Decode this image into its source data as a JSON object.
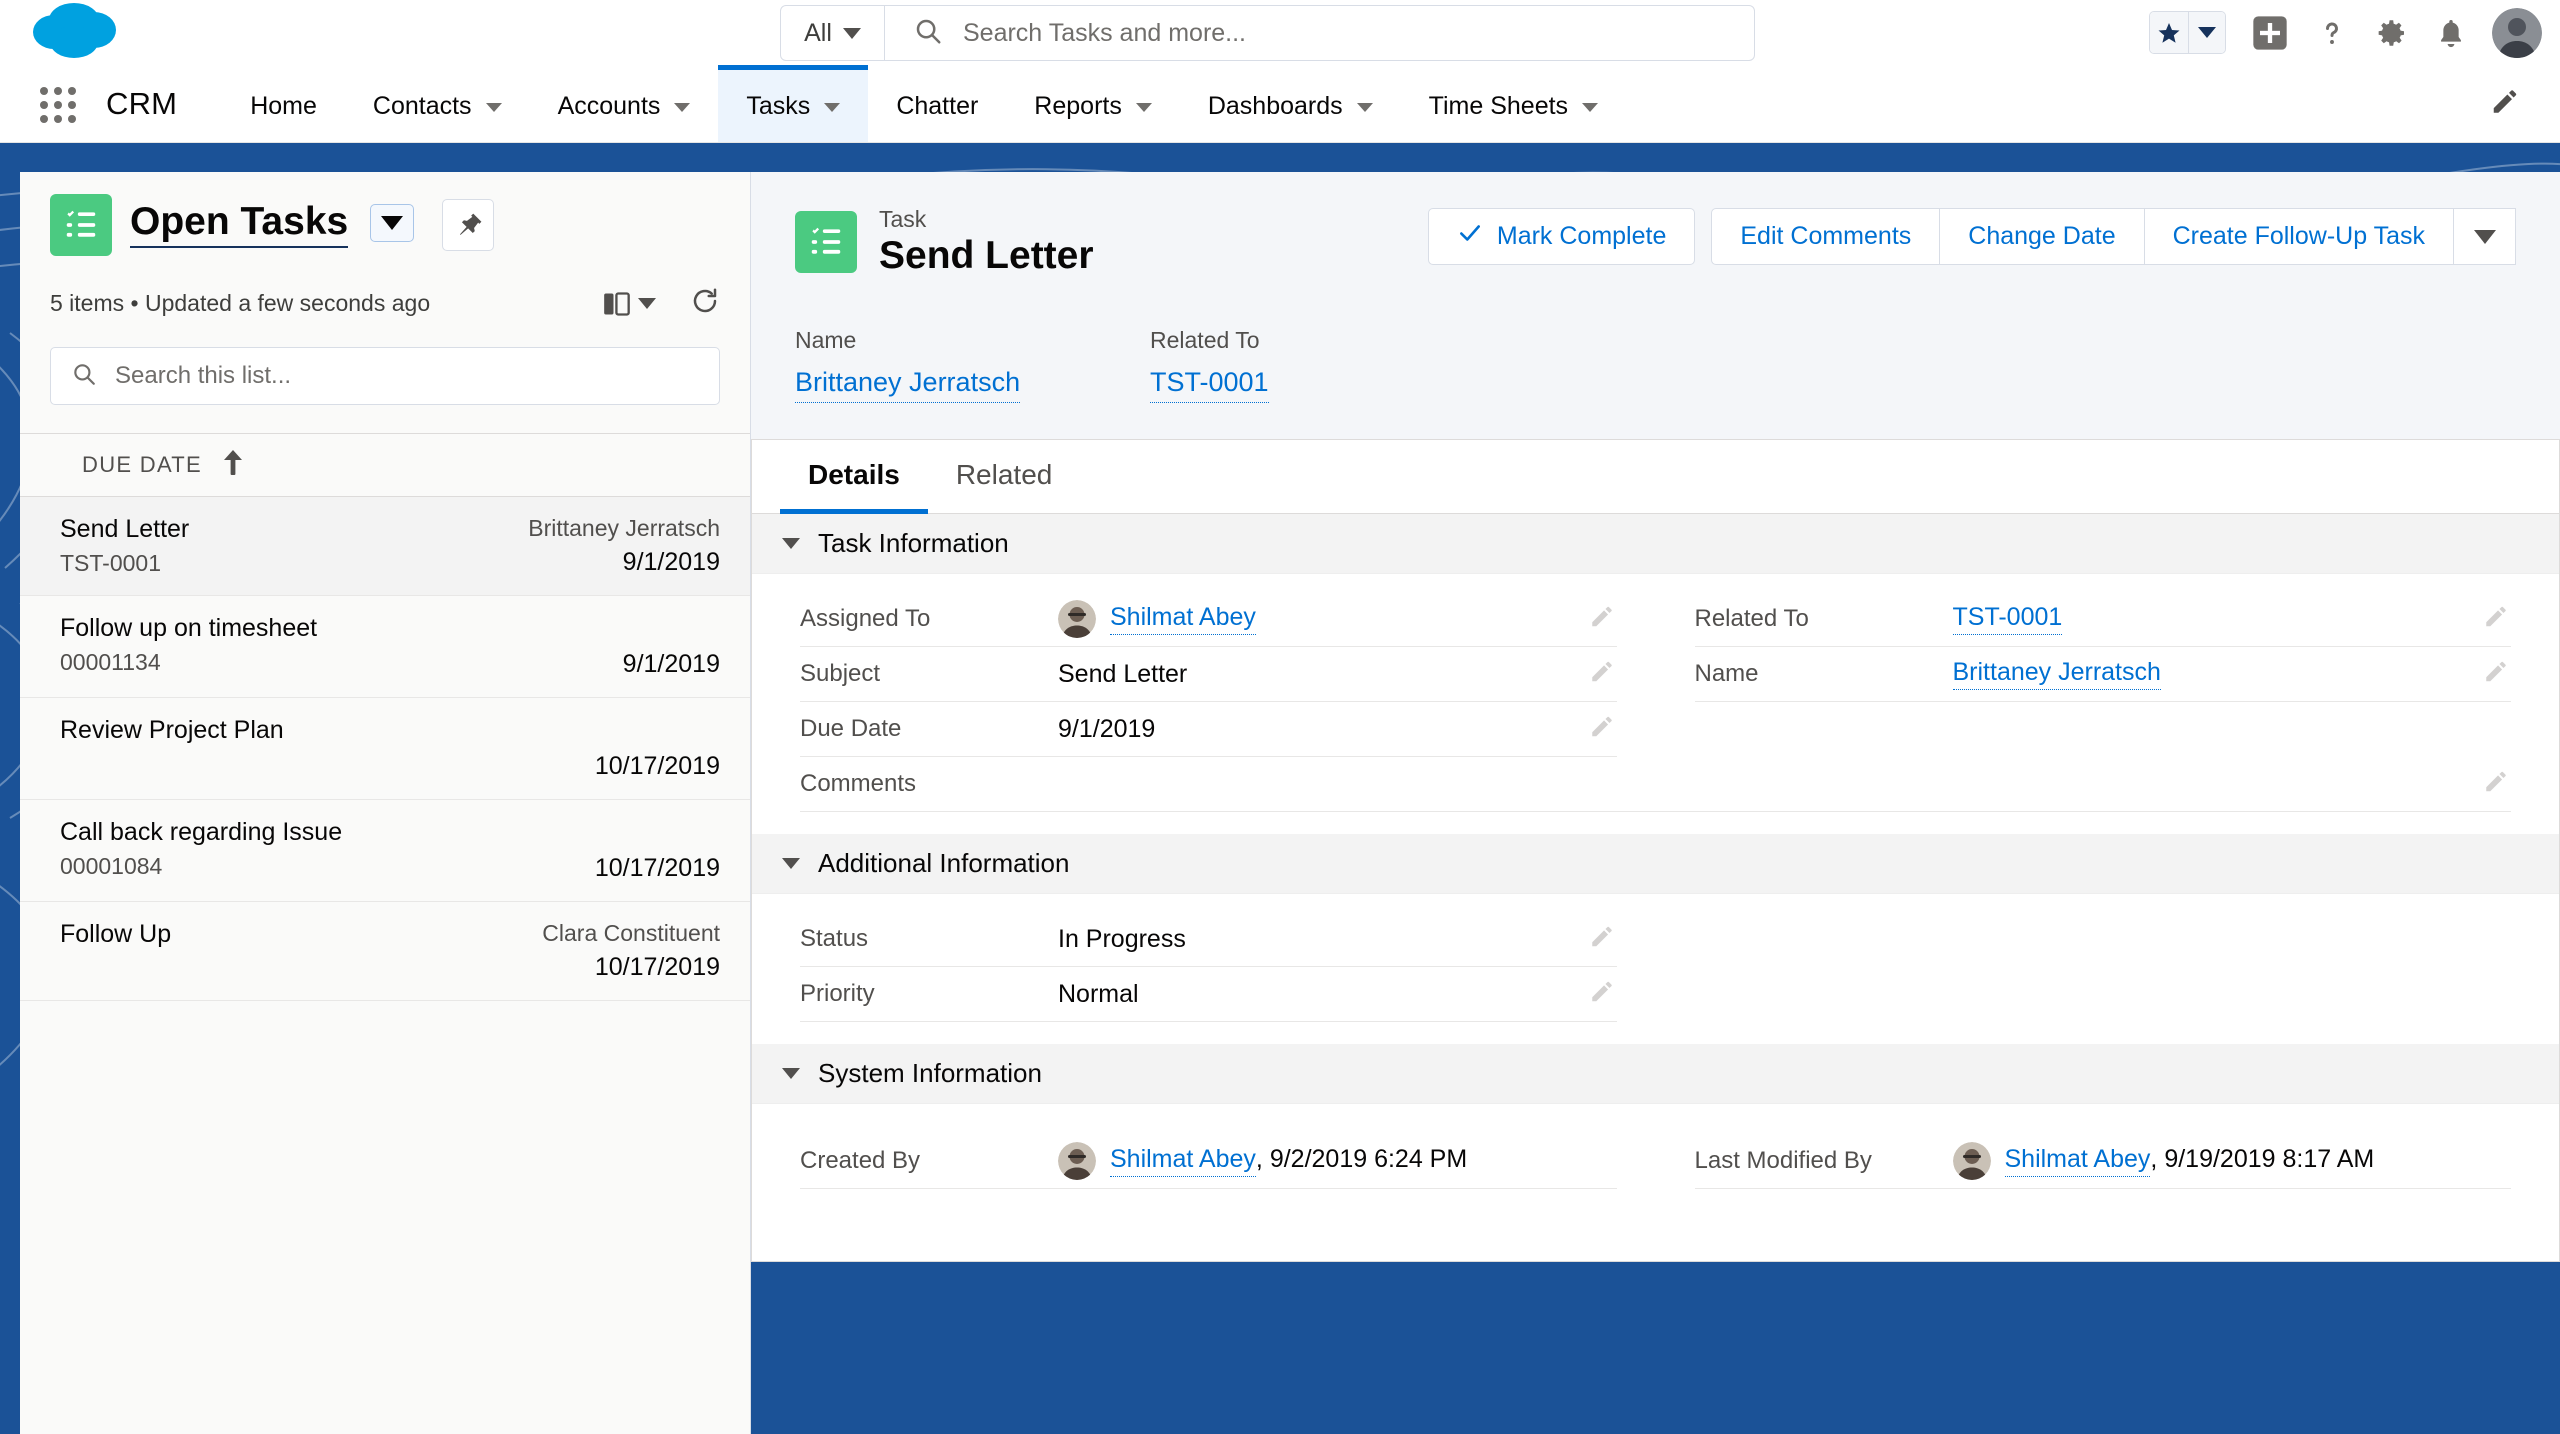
{
  "header": {
    "logo": "salesforce-cloud-logo",
    "search": {
      "scope_label": "All",
      "placeholder": "Search Tasks and more...",
      "value": ""
    },
    "icons": [
      "favorites-star-icon",
      "favorites-caret-icon",
      "add-icon",
      "help-icon",
      "setup-gear-icon",
      "notifications-bell-icon",
      "user-avatar"
    ]
  },
  "nav": {
    "app_name": "CRM",
    "items": [
      {
        "label": "Home",
        "has_caret": false,
        "active": false
      },
      {
        "label": "Contacts",
        "has_caret": true,
        "active": false
      },
      {
        "label": "Accounts",
        "has_caret": true,
        "active": false
      },
      {
        "label": "Tasks",
        "has_caret": true,
        "active": true
      },
      {
        "label": "Chatter",
        "has_caret": false,
        "active": false
      },
      {
        "label": "Reports",
        "has_caret": true,
        "active": false
      },
      {
        "label": "Dashboards",
        "has_caret": true,
        "active": false
      },
      {
        "label": "Time Sheets",
        "has_caret": true,
        "active": false
      }
    ],
    "edit_icon": "pencil-icon"
  },
  "list_panel": {
    "title": "Open Tasks",
    "meta": "5 items • Updated a few seconds ago",
    "search_placeholder": "Search this list...",
    "column_header": "DUE DATE",
    "sort_direction": "ascending",
    "rows": [
      {
        "title": "Send Letter",
        "subtitle": "TST-0001",
        "name": "Brittaney Jerratsch",
        "date": "9/1/2019",
        "selected": true
      },
      {
        "title": "Follow up on timesheet",
        "subtitle": "00001134",
        "name": "",
        "date": "9/1/2019",
        "selected": false
      },
      {
        "title": "Review Project Plan",
        "subtitle": "",
        "name": "",
        "date": "10/17/2019",
        "selected": false
      },
      {
        "title": "Call back regarding Issue",
        "subtitle": "00001084",
        "name": "",
        "date": "10/17/2019",
        "selected": false
      },
      {
        "title": "Follow Up",
        "subtitle": "",
        "name": "Clara Constituent",
        "date": "10/17/2019",
        "selected": false
      }
    ]
  },
  "record": {
    "object_label": "Task",
    "record_title": "Send Letter",
    "actions": {
      "mark_complete": "Mark Complete",
      "edit_comments": "Edit Comments",
      "change_date": "Change Date",
      "create_follow_up": "Create Follow-Up Task"
    },
    "highlights": [
      {
        "label": "Name",
        "value": "Brittaney Jerratsch"
      },
      {
        "label": "Related To",
        "value": "TST-0001"
      }
    ],
    "tabs": [
      {
        "label": "Details",
        "active": true
      },
      {
        "label": "Related",
        "active": false
      }
    ],
    "sections": [
      {
        "title": "Task Information",
        "left_fields": [
          {
            "label": "Assigned To",
            "value": "Shilmat Abey",
            "link": true,
            "avatar": true
          },
          {
            "label": "Subject",
            "value": "Send Letter",
            "link": false,
            "avatar": false
          },
          {
            "label": "Due Date",
            "value": "9/1/2019",
            "link": false,
            "avatar": false
          },
          {
            "label": "Comments",
            "value": "",
            "link": false,
            "avatar": false
          }
        ],
        "right_fields": [
          {
            "label": "Related To",
            "value": "TST-0001",
            "link": true,
            "avatar": false
          },
          {
            "label": "Name",
            "value": "Brittaney Jerratsch",
            "link": true,
            "avatar": false
          }
        ]
      },
      {
        "title": "Additional Information",
        "left_fields": [
          {
            "label": "Status",
            "value": "In Progress",
            "link": false,
            "avatar": false
          },
          {
            "label": "Priority",
            "value": "Normal",
            "link": false,
            "avatar": false
          }
        ],
        "right_fields": []
      },
      {
        "title": "System Information",
        "left_fields": [
          {
            "label": "Created By",
            "value": "Shilmat Abey",
            "suffix": ", 9/2/2019 6:24 PM",
            "link": true,
            "avatar": true
          }
        ],
        "right_fields": [
          {
            "label": "Last Modified By",
            "value": "Shilmat Abey",
            "suffix": ", 9/19/2019 8:17 AM",
            "link": true,
            "avatar": true
          }
        ]
      }
    ]
  },
  "colors": {
    "brand_blue": "#0070d2",
    "page_backdrop": "#1b5297",
    "object_icon_green": "#4bca81",
    "panel_gray": "#f4f6f9"
  }
}
